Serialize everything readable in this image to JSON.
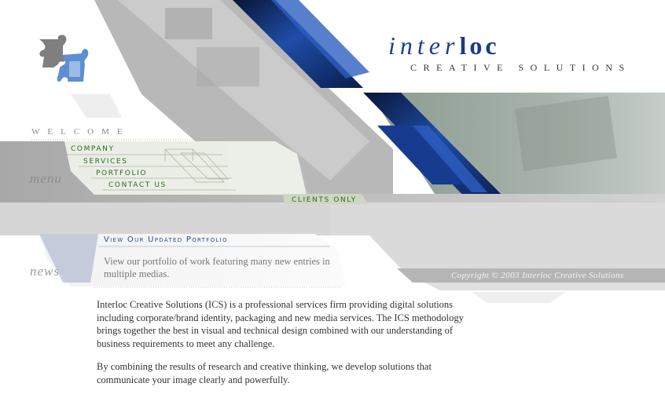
{
  "brand": {
    "name_light": "inter",
    "name_bold": "loc",
    "tagline": "CREATIVE SOLUTIONS"
  },
  "welcome": "WELCOME",
  "labels": {
    "menu": "menu",
    "news": "news"
  },
  "nav": {
    "company": "COMPANY",
    "services": "SERVICES",
    "portfolio": "PORTFOLIO",
    "contact": "CONTACT US",
    "clients": "CLIENTS ONLY"
  },
  "news": {
    "title": "View Our Updated Portfolio",
    "body": "View our portfolio of work featuring many new entries in multiple medias."
  },
  "copyright": "Copyright © 2003 Interloc Creative Solutions",
  "intro": {
    "para1": "Interloc Creative Solutions (ICS) is a professional services firm providing digital solutions including corporate/brand identity, packaging and new media services. The ICS methodology brings together the best in visual and technical design combined with our understanding of business requirements to meet any challenge.",
    "para2": "By combining the results of research and creative thinking, we develop solutions that communicate your image clearly and powerfully."
  },
  "colors": {
    "brand_blue": "#1b3a86",
    "nav_green": "#2a6b1c",
    "news_blue": "#1e4f8f"
  }
}
